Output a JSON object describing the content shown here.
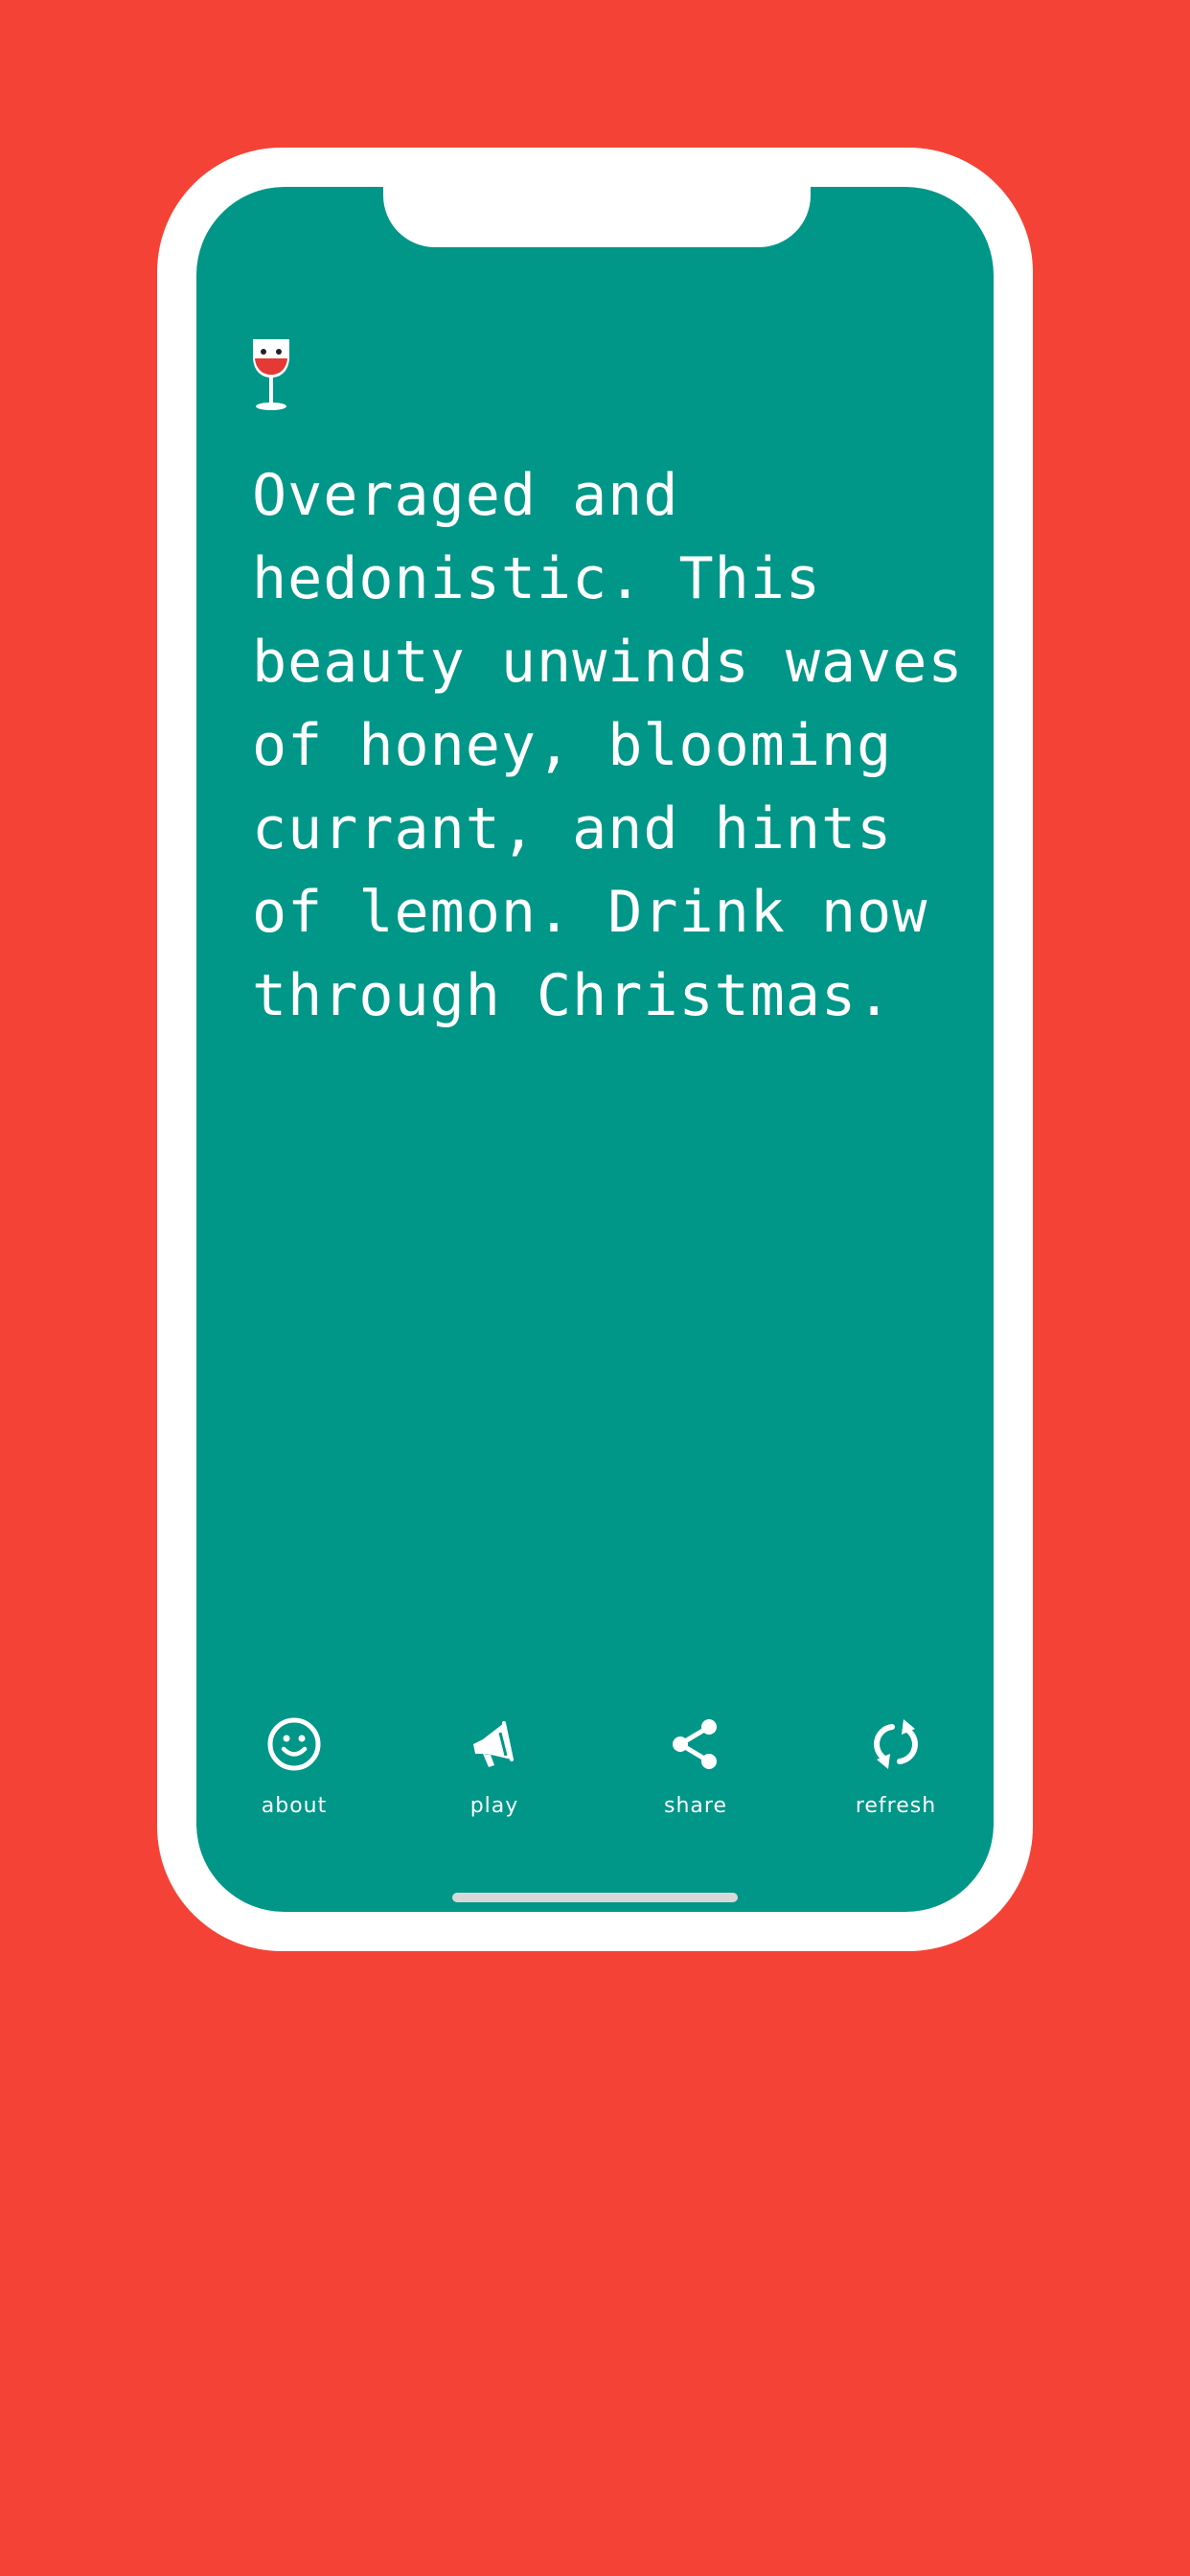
{
  "colors": {
    "background": "#f44336",
    "screen": "#009688",
    "frame": "#ffffff",
    "wine": "#e53935"
  },
  "header": {
    "icon": "wine-glass-icon"
  },
  "review": {
    "text": "Overaged and\nhedonistic. This\nbeauty unwinds waves\nof honey, blooming\ncurrant, and hints\nof lemon. Drink now\nthrough Christmas."
  },
  "toolbar": {
    "items": [
      {
        "label": "about",
        "icon": "smiley-face-icon"
      },
      {
        "label": "play",
        "icon": "megaphone-icon"
      },
      {
        "label": "share",
        "icon": "share-icon"
      },
      {
        "label": "refresh",
        "icon": "refresh-icon"
      }
    ]
  }
}
